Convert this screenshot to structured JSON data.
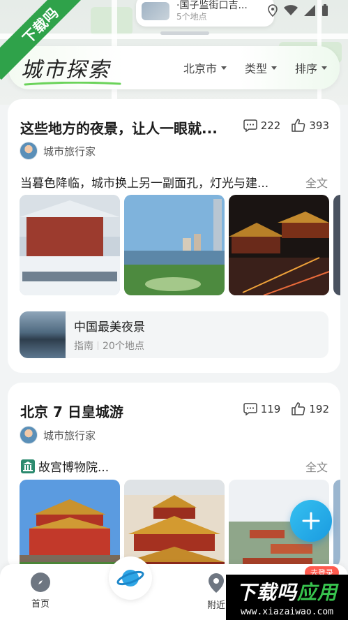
{
  "map": {
    "card_title": "·国子监街口吉...",
    "card_subtitle": "5个地点"
  },
  "watermark": {
    "ribbon": "下载吗",
    "badge_title_a": "下载吗",
    "badge_title_b": "应用",
    "badge_url": "www.xiazaiwao.com"
  },
  "header": {
    "logo": "城市探索",
    "filters": [
      {
        "label": "北京市"
      },
      {
        "label": "类型"
      },
      {
        "label": "排序"
      }
    ]
  },
  "cards": [
    {
      "title": "这些地方的夜景，让人一眼就...",
      "comments": "222",
      "likes": "393",
      "author": "城市旅行家",
      "desc": "当暮色降临，城市换上另一副面孔，灯光与建...",
      "more": "全文",
      "guide": {
        "title": "中国最美夜景",
        "type": "指南",
        "count": "20个地点"
      }
    },
    {
      "title": "北京 7 日皇城游",
      "comments": "119",
      "likes": "192",
      "author": "城市旅行家",
      "poi": "故宫博物院...",
      "more": "全文"
    }
  ],
  "nav": {
    "home": "首页",
    "nearby": "附近",
    "login_badge": "去登录"
  },
  "colors": {
    "accent": "#1a9be0",
    "watermark_green": "#2fa24a",
    "badge_red": "#ff5a4e"
  }
}
